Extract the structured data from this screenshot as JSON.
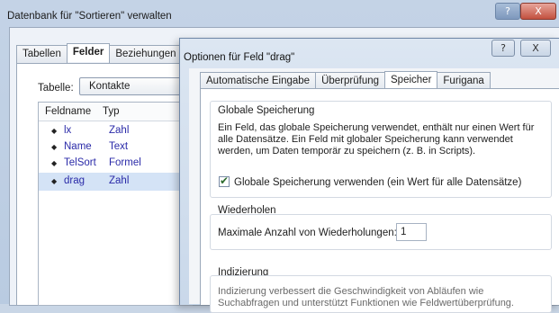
{
  "back_window": {
    "title": "Datenbank für \"Sortieren\" verwalten",
    "help_label": "?",
    "close_label": "X",
    "tabs": [
      {
        "label": "Tabellen"
      },
      {
        "label": "Felder"
      },
      {
        "label": "Beziehungen"
      }
    ],
    "table_label": "Tabelle:",
    "table_value": "Kontakte",
    "field_list": {
      "headers": [
        "Feldname",
        "Typ"
      ],
      "rows": [
        {
          "name": "lx",
          "type": "Zahl"
        },
        {
          "name": "Name",
          "type": "Text"
        },
        {
          "name": "TelSort",
          "type": "Formel"
        },
        {
          "name": "drag",
          "type": "Zahl"
        }
      ]
    }
  },
  "dialog": {
    "title": "Optionen für Feld \"drag\"",
    "help_label": "?",
    "close_label": "X",
    "tabs": [
      {
        "label": "Automatische Eingabe"
      },
      {
        "label": "Überprüfung"
      },
      {
        "label": "Speicher"
      },
      {
        "label": "Furigana"
      }
    ],
    "global_storage": {
      "title": "Globale Speicherung",
      "description": "Ein Feld, das globale Speicherung verwendet, enthält nur einen Wert für alle Datensätze. Ein Feld mit globaler Speicherung kann verwendet werden, um Daten temporär zu speichern (z. B. in Scripts).",
      "checkbox_label": "Globale Speicherung verwenden (ein Wert für alle Datensätze)",
      "checkbox_mark": "✔"
    },
    "repeat": {
      "title": "Wiederholen",
      "label": "Maximale Anzahl von Wiederholungen:",
      "value": "1"
    },
    "indexing": {
      "title": "Indizierung",
      "description": "Indizierung verbessert die Geschwindigkeit von Abläufen wie Suchabfragen und unterstützt Funktionen wie Feldwertüberprüfung."
    }
  }
}
